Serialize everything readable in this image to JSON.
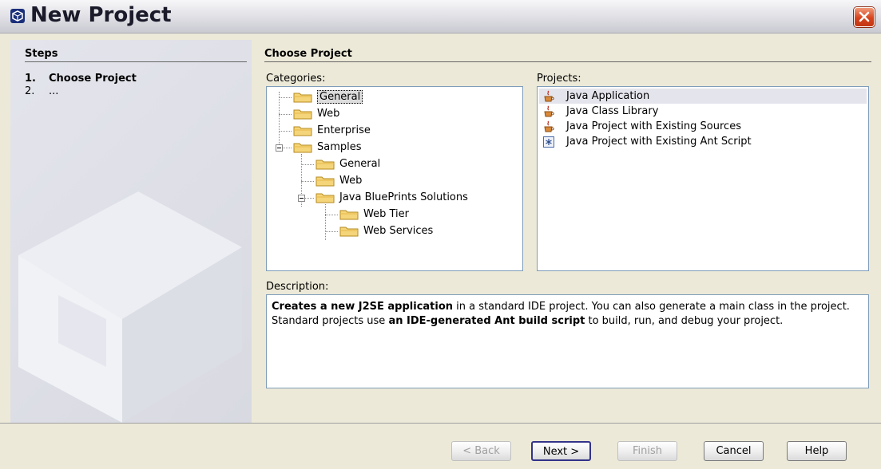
{
  "window": {
    "title": "New Project"
  },
  "steps": {
    "heading": "Steps",
    "items": [
      {
        "num": "1.",
        "label": "Choose Project"
      },
      {
        "num": "2.",
        "label": "..."
      }
    ]
  },
  "main": {
    "heading": "Choose Project",
    "categories_label": "Categories:",
    "projects_label": "Projects:",
    "description_label": "Description:"
  },
  "categories": [
    {
      "label": "General",
      "level": 0,
      "selected": true
    },
    {
      "label": "Web",
      "level": 0
    },
    {
      "label": "Enterprise",
      "level": 0
    },
    {
      "label": "Samples",
      "level": 0,
      "expanded": true
    },
    {
      "label": "General",
      "level": 1
    },
    {
      "label": "Web",
      "level": 1
    },
    {
      "label": "Java BluePrints Solutions",
      "level": 1,
      "expanded": true
    },
    {
      "label": "Web Tier",
      "level": 2
    },
    {
      "label": "Web Services",
      "level": 2
    }
  ],
  "projects": [
    {
      "label": "Java Application",
      "icon": "java-cup-icon",
      "selected": true
    },
    {
      "label": "Java Class Library",
      "icon": "java-cup-icon"
    },
    {
      "label": "Java Project with Existing Sources",
      "icon": "java-cup-icon"
    },
    {
      "label": "Java Project with Existing Ant Script",
      "icon": "ant-script-icon"
    }
  ],
  "description": {
    "parts": [
      {
        "text": "Creates a new J2SE application",
        "bold": true
      },
      {
        "text": " in a standard IDE project. You can also generate a main class in the project. Standard projects use ",
        "bold": false
      },
      {
        "text": "an IDE-generated Ant build script",
        "bold": true
      },
      {
        "text": " to build, run, and debug your project.",
        "bold": false
      }
    ]
  },
  "buttons": {
    "back": "< Back",
    "next": "Next >",
    "finish": "Finish",
    "cancel": "Cancel",
    "help": "Help"
  },
  "colors": {
    "selection": "#e4e4ec",
    "border": "#7f9db9",
    "close": "#d6431c"
  }
}
